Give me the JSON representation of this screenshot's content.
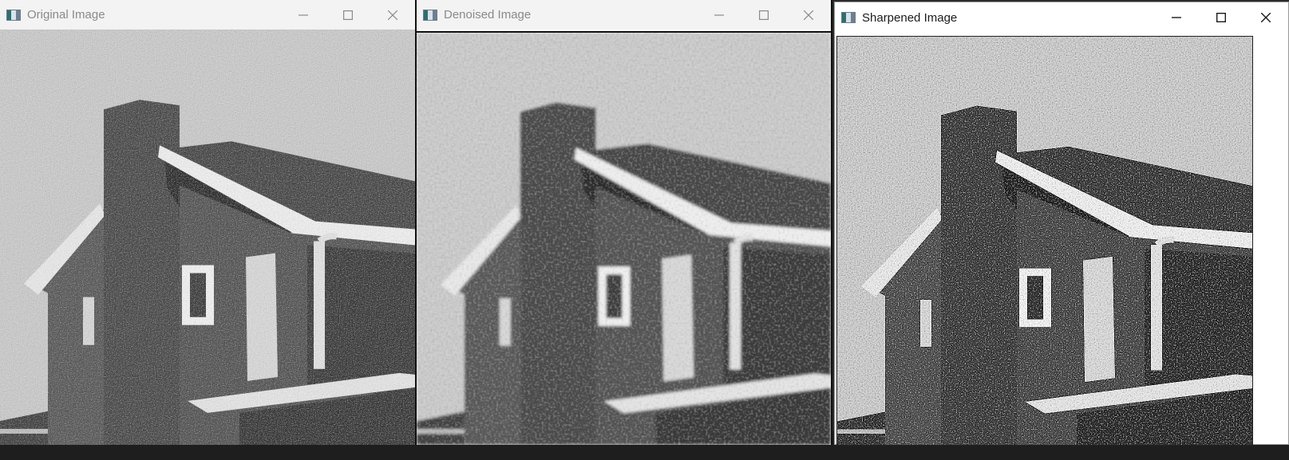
{
  "windows": [
    {
      "title": "Original Image",
      "state": "inactive",
      "image": "noisy grayscale photo of a house with a chimney"
    },
    {
      "title": "Denoised Image",
      "state": "inactive",
      "image": "blurred grayscale photo of a house with a chimney"
    },
    {
      "title": "Sharpened Image",
      "state": "active",
      "image": "sharpened grayscale photo of a house with a chimney"
    }
  ],
  "controls": {
    "minimize_icon": "minimize-icon",
    "maximize_icon": "maximize-icon",
    "close_icon": "close-icon"
  }
}
